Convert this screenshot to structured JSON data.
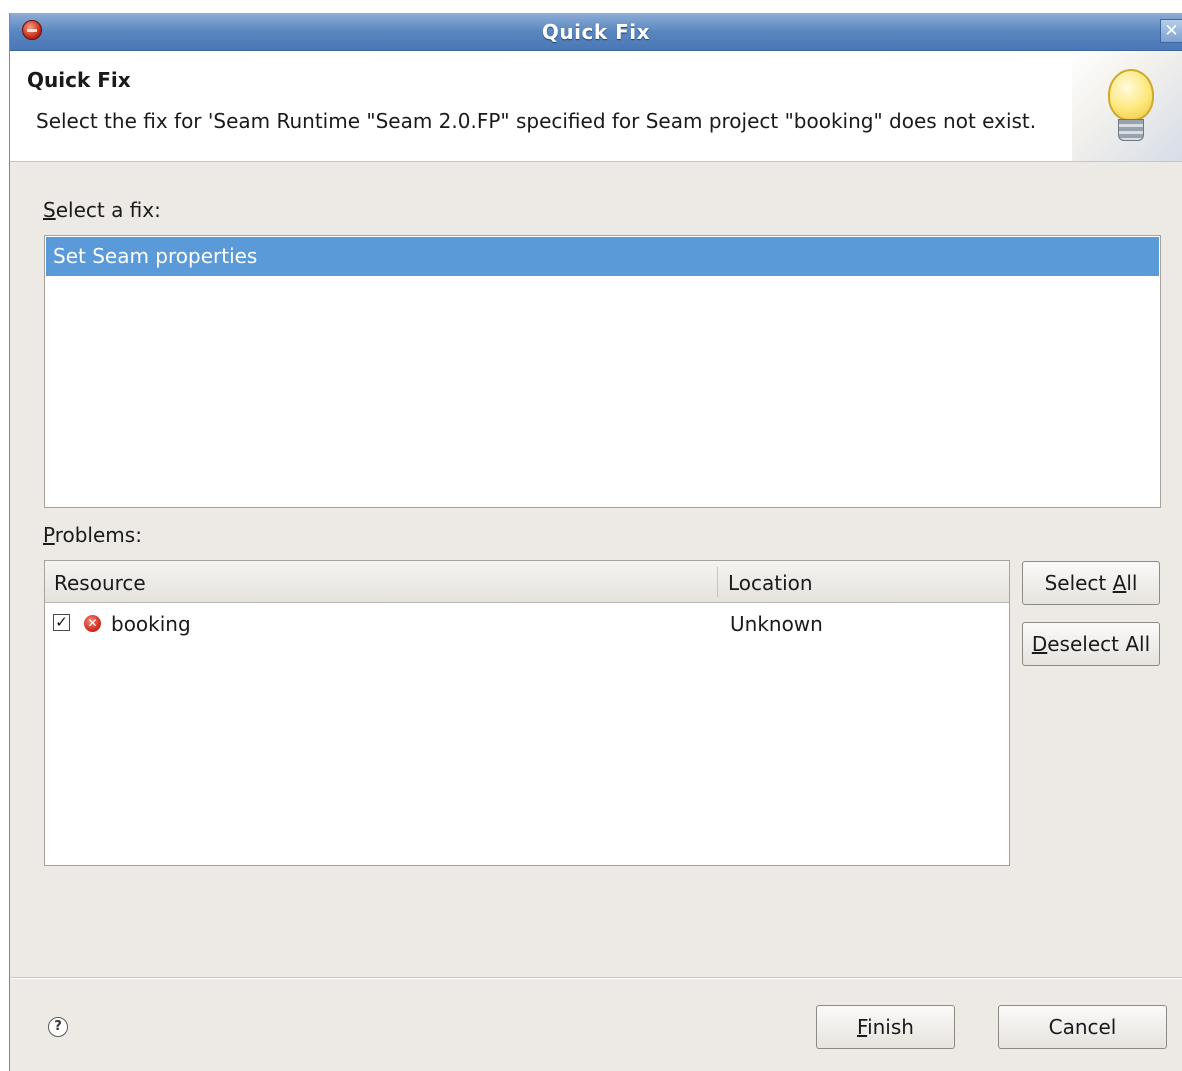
{
  "window": {
    "title": "Quick Fix",
    "close_glyph": "✕"
  },
  "header": {
    "title": "Quick Fix",
    "message": "Select the fix for 'Seam Runtime \"Seam 2.0.FP\" specified for Seam project \"booking\" does not exist.",
    "icon": "lightbulb-icon"
  },
  "fixes": {
    "label_mnemonic": "S",
    "label_rest": "elect a fix:",
    "items": [
      {
        "label": "Set Seam properties",
        "selected": true
      }
    ]
  },
  "problems": {
    "label_mnemonic": "P",
    "label_rest": "roblems:",
    "columns": [
      "Resource",
      "Location"
    ],
    "rows": [
      {
        "checked": true,
        "check_glyph": "✓",
        "resource": "booking",
        "location": "Unknown",
        "severity": "error"
      }
    ]
  },
  "side_buttons": {
    "select_all_prefix": "Select ",
    "select_all_mnemonic": "A",
    "select_all_suffix": "ll",
    "deselect_all_mnemonic": "D",
    "deselect_all_suffix": "eselect All"
  },
  "footer": {
    "help_glyph": "?",
    "finish_mnemonic": "F",
    "finish_suffix": "inish",
    "cancel_label": "Cancel"
  },
  "colors": {
    "selection": "#5b9ad9",
    "titlebar": "#5a86c0",
    "dialog_bg": "#edeae5"
  }
}
